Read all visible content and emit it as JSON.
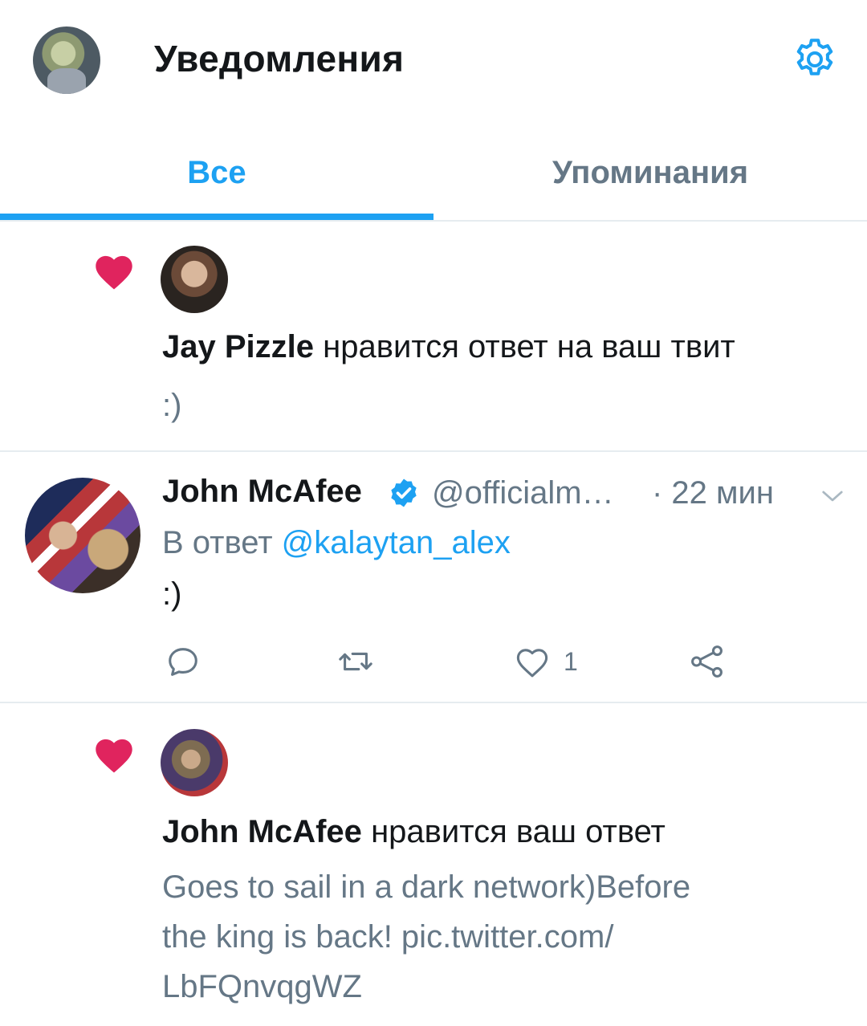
{
  "header": {
    "title": "Уведомления"
  },
  "tabs": [
    {
      "label": "Все",
      "active": true
    },
    {
      "label": "Упоминания",
      "active": false
    }
  ],
  "notifications": [
    {
      "type": "like",
      "user_name": "Jay Pizzle",
      "action_text": "нравится ответ на ваш твит",
      "quote": ":)"
    },
    {
      "type": "like",
      "user_name": "John McAfee",
      "action_text": "нравится ваш ответ",
      "quote_lines": [
        "Goes to sail in a dark network)Before",
        "the king is back! pic.twitter.com/",
        "LbFQnvqgWZ"
      ]
    }
  ],
  "tweet": {
    "name": "John McAfee",
    "verified": true,
    "handle": "@officialm…",
    "time": "· 22 мин",
    "reply_prefix": "В ответ",
    "reply_to": "@kalaytan_alex",
    "body": ":)",
    "like_count": "1",
    "actions": [
      "reply-icon",
      "retweet-icon",
      "like-icon",
      "share-icon"
    ]
  },
  "colors": {
    "accent": "#1da1f2",
    "heart": "#e0245e",
    "secondary_text": "#657786",
    "divider": "#e6ecf0"
  }
}
